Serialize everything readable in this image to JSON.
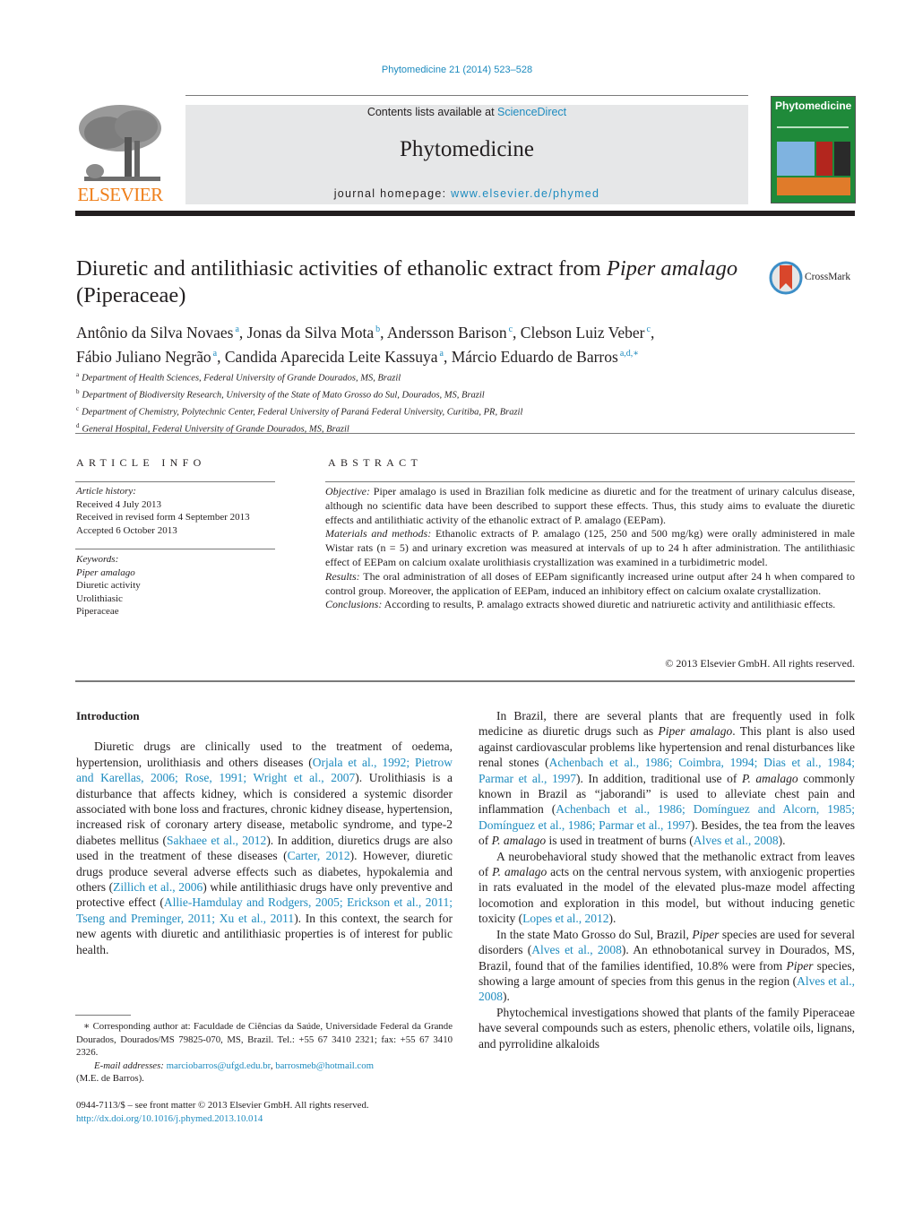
{
  "header": {
    "citation": "Phytomedicine 21 (2014) 523–528",
    "contents_prefix": "Contents lists available at ",
    "contents_link": "ScienceDirect",
    "journal_name": "Phytomedicine",
    "homepage_prefix": "journal homepage: ",
    "homepage_link": "www.elsevier.de/phymed",
    "publisher_logo_text": "ELSEVIER",
    "cover_title": "Phytomedicine",
    "crossmark_label": "CrossMark"
  },
  "article": {
    "title_part1": "Diuretic and antilithiasic activities of ethanolic extract from ",
    "title_italic": "Piper amalago",
    "title_part2": " (Piperaceae)",
    "authors": [
      {
        "name": "Antônio da Silva Novaes",
        "sup": "a",
        "sep": ", "
      },
      {
        "name": "Jonas da Silva Mota",
        "sup": "b",
        "sep": ", "
      },
      {
        "name": "Andersson Barison",
        "sup": "c",
        "sep": ", "
      },
      {
        "name": "Clebson Luiz Veber",
        "sup": "c",
        "sep": ","
      },
      {
        "name": "Fábio Juliano Negrão",
        "sup": "a",
        "sep": ", "
      },
      {
        "name": "Candida Aparecida Leite Kassuya",
        "sup": "a",
        "sep": ", "
      },
      {
        "name": "Márcio Eduardo de Barros",
        "sup": "a,d,∗",
        "sep": ""
      }
    ],
    "affiliations": [
      {
        "key": "a",
        "text": "Department of Health Sciences, Federal University of Grande Dourados, MS, Brazil"
      },
      {
        "key": "b",
        "text": "Department of Biodiversity Research, University of the State of Mato Grosso do Sul, Dourados, MS, Brazil"
      },
      {
        "key": "c",
        "text": "Department of Chemistry, Polytechnic Center, Federal University of Paraná Federal University, Curitiba, PR, Brazil"
      },
      {
        "key": "d",
        "text": "General Hospital, Federal University of Grande Dourados, MS, Brazil"
      }
    ]
  },
  "article_info": {
    "heading": "ARTICLE INFO",
    "history_label": "Article history:",
    "received": "Received 4 July 2013",
    "revised": "Received in revised form 4 September 2013",
    "accepted": "Accepted 6 October 2013",
    "keywords_label": "Keywords:",
    "keywords": [
      "Piper amalago",
      "Diuretic activity",
      "Urolithiasic",
      "Piperaceae"
    ]
  },
  "abstract": {
    "heading": "ABSTRACT",
    "objective_label": "Objective:",
    "objective_text": " Piper amalago is used in Brazilian folk medicine as diuretic and for the treatment of urinary calculus disease, although no scientific data have been described to support these effects. Thus, this study aims to evaluate the diuretic effects and antilithiatic activity of the ethanolic extract of P. amalago (EEPam).",
    "methods_label": "Materials and methods:",
    "methods_text": " Ethanolic extracts of P. amalago (125, 250 and 500 mg/kg) were orally administered in male Wistar rats (n = 5) and urinary excretion was measured at intervals of up to 24 h after administration. The antilithiasic effect of EEPam on calcium oxalate urolithiasis crystallization was examined in a turbidimetric model.",
    "results_label": "Results:",
    "results_text": " The oral administration of all doses of EEPam significantly increased urine output after 24 h when compared to control group. Moreover, the application of EEPam, induced an inhibitory effect on calcium oxalate crystallization.",
    "conclusions_label": "Conclusions:",
    "conclusions_text": " According to results, P. amalago extracts showed diuretic and natriuretic activity and antilithiasic effects.",
    "copyright": "© 2013 Elsevier GmbH. All rights reserved."
  },
  "body": {
    "intro_heading": "Introduction",
    "left_para": [
      {
        "t": "Diuretic drugs are clinically used to the treatment of oedema, hypertension, urolithiasis and others diseases ("
      },
      {
        "l": "Orjala et al., 1992; Pietrow and Karellas, 2006; Rose, 1991; Wright et al., 2007"
      },
      {
        "t": "). Urolithiasis is a disturbance that affects kidney, which is considered a systemic disorder associated with bone loss and fractures, chronic kidney disease, hypertension, increased risk of coronary artery disease, metabolic syndrome, and type-2 diabetes mellitus ("
      },
      {
        "l": "Sakhaee et al., 2012"
      },
      {
        "t": "). In addition, diuretics drugs are also used in the treatment of these diseases ("
      },
      {
        "l": "Carter, 2012"
      },
      {
        "t": "). However, diuretic drugs produce several adverse effects such as diabetes, hypokalemia and others ("
      },
      {
        "l": "Zillich et al., 2006"
      },
      {
        "t": ") while antilithiasic drugs have only preventive and protective effect ("
      },
      {
        "l": "Allie-Hamdulay and Rodgers, 2005; Erickson et al., 2011; Tseng and Preminger, 2011; Xu et al., 2011"
      },
      {
        "t": "). In this context, the search for new agents with diuretic and antilithiasic properties is of interest for public health."
      }
    ],
    "right_paras": [
      [
        {
          "t": "In Brazil, there are several plants that are frequently used in folk medicine as diuretic drugs such as "
        },
        {
          "i": "Piper amalago"
        },
        {
          "t": ". This plant is also used against cardiovascular problems like hypertension and renal disturbances like renal stones ("
        },
        {
          "l": "Achenbach et al., 1986; Coimbra, 1994; Dias et al., 1984; Parmar et al., 1997"
        },
        {
          "t": "). In addition, traditional use of "
        },
        {
          "i": "P. amalago"
        },
        {
          "t": " commonly known in Brazil as “jaborandi” is used to alleviate chest pain and inflammation ("
        },
        {
          "l": "Achenbach et al., 1986; Domínguez and Alcorn, 1985; Domínguez et al., 1986; Parmar et al., 1997"
        },
        {
          "t": "). Besides, the tea from the leaves of "
        },
        {
          "i": "P. amalago"
        },
        {
          "t": " is used in treatment of burns ("
        },
        {
          "l": "Alves et al., 2008"
        },
        {
          "t": ")."
        }
      ],
      [
        {
          "t": "A neurobehavioral study showed that the methanolic extract from leaves of "
        },
        {
          "i": "P. amalago"
        },
        {
          "t": " acts on the central nervous system, with anxiogenic properties in rats evaluated in the model of the elevated plus-maze model affecting locomotion and exploration in this model, but without inducing genetic toxicity ("
        },
        {
          "l": "Lopes et al., 2012"
        },
        {
          "t": ")."
        }
      ],
      [
        {
          "t": "In the state Mato Grosso do Sul, Brazil, "
        },
        {
          "i": "Piper"
        },
        {
          "t": " species are used for several disorders ("
        },
        {
          "l": "Alves et al., 2008"
        },
        {
          "t": "). An ethnobotanical survey in Dourados, MS, Brazil, found that of the families identified, 10.8% were from "
        },
        {
          "i": "Piper"
        },
        {
          "t": " species, showing a large amount of species from this genus in the region ("
        },
        {
          "l": "Alves et al., 2008"
        },
        {
          "t": ")."
        }
      ],
      [
        {
          "t": "Phytochemical investigations showed that plants of the family Piperaceae have several compounds such as esters, phenolic ethers, volatile oils, lignans, and pyrrolidine alkaloids"
        }
      ]
    ]
  },
  "footnote": {
    "corresponding": "∗ Corresponding author at: Faculdade de Ciências da Saúde, Universidade Federal da Grande Dourados, Dourados/MS 79825-070, MS, Brazil. Tel.: +55 67 3410 2321; fax: +55 67 3410 2326.",
    "email_label": "E-mail addresses:",
    "email1": "marciobarros@ufgd.edu.br",
    "email2": "barrosmeb@hotmail.com",
    "email_owner": "(M.E. de Barros).",
    "front_matter": "0944-7113/$ – see front matter © 2013 Elsevier GmbH. All rights reserved.",
    "doi": "http://dx.doi.org/10.1016/j.phymed.2013.10.014"
  },
  "colors": {
    "link": "#1d8bbf",
    "elsevier_orange": "#ef7f1a",
    "masthead_gray": "#e6e7e8",
    "cover_green": "#1f8a3a"
  }
}
